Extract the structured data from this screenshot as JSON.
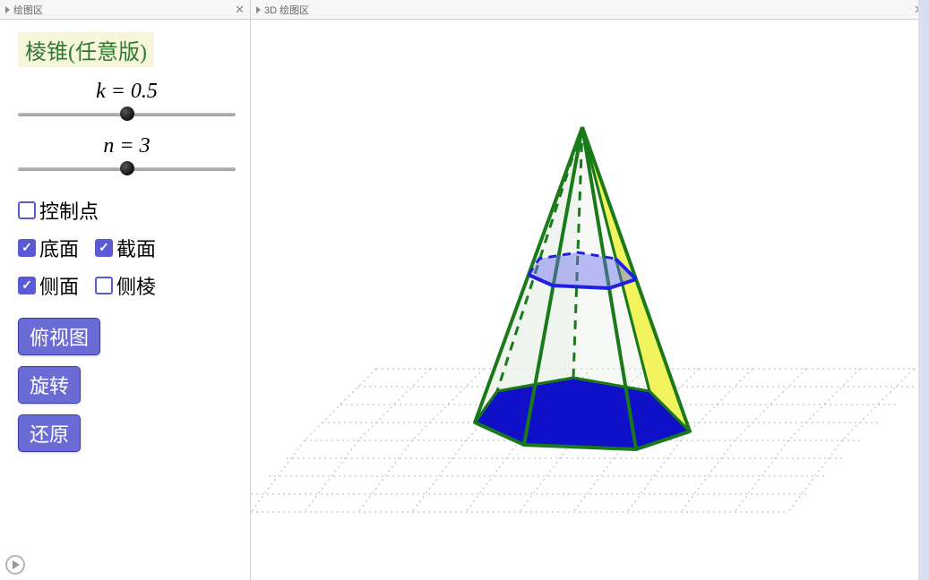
{
  "sidebar": {
    "header": "绘图区",
    "title": "棱锥(任意版)",
    "slider_k": {
      "label": "k = 0.5",
      "position_pct": 50
    },
    "slider_n": {
      "label": "n = 3",
      "position_pct": 50
    },
    "checks": {
      "control_points": {
        "label": "控制点",
        "checked": false
      },
      "base": {
        "label": "底面",
        "checked": true
      },
      "section": {
        "label": "截面",
        "checked": true
      },
      "side_face": {
        "label": "侧面",
        "checked": true
      },
      "side_edge": {
        "label": "侧棱",
        "checked": false
      }
    },
    "buttons": {
      "top_view": "俯视图",
      "rotate": "旋转",
      "reset": "还原"
    }
  },
  "main": {
    "header": "3D 绘图区"
  },
  "colors": {
    "accent": "#6b6bd6",
    "title_fg": "#2e7a2e",
    "title_bg": "#f6f6dc",
    "pyramid_edge": "#1a7a1a",
    "base_fill": "#1010c8",
    "side_fill": "#f7f700",
    "section_edge": "#2020e0"
  }
}
